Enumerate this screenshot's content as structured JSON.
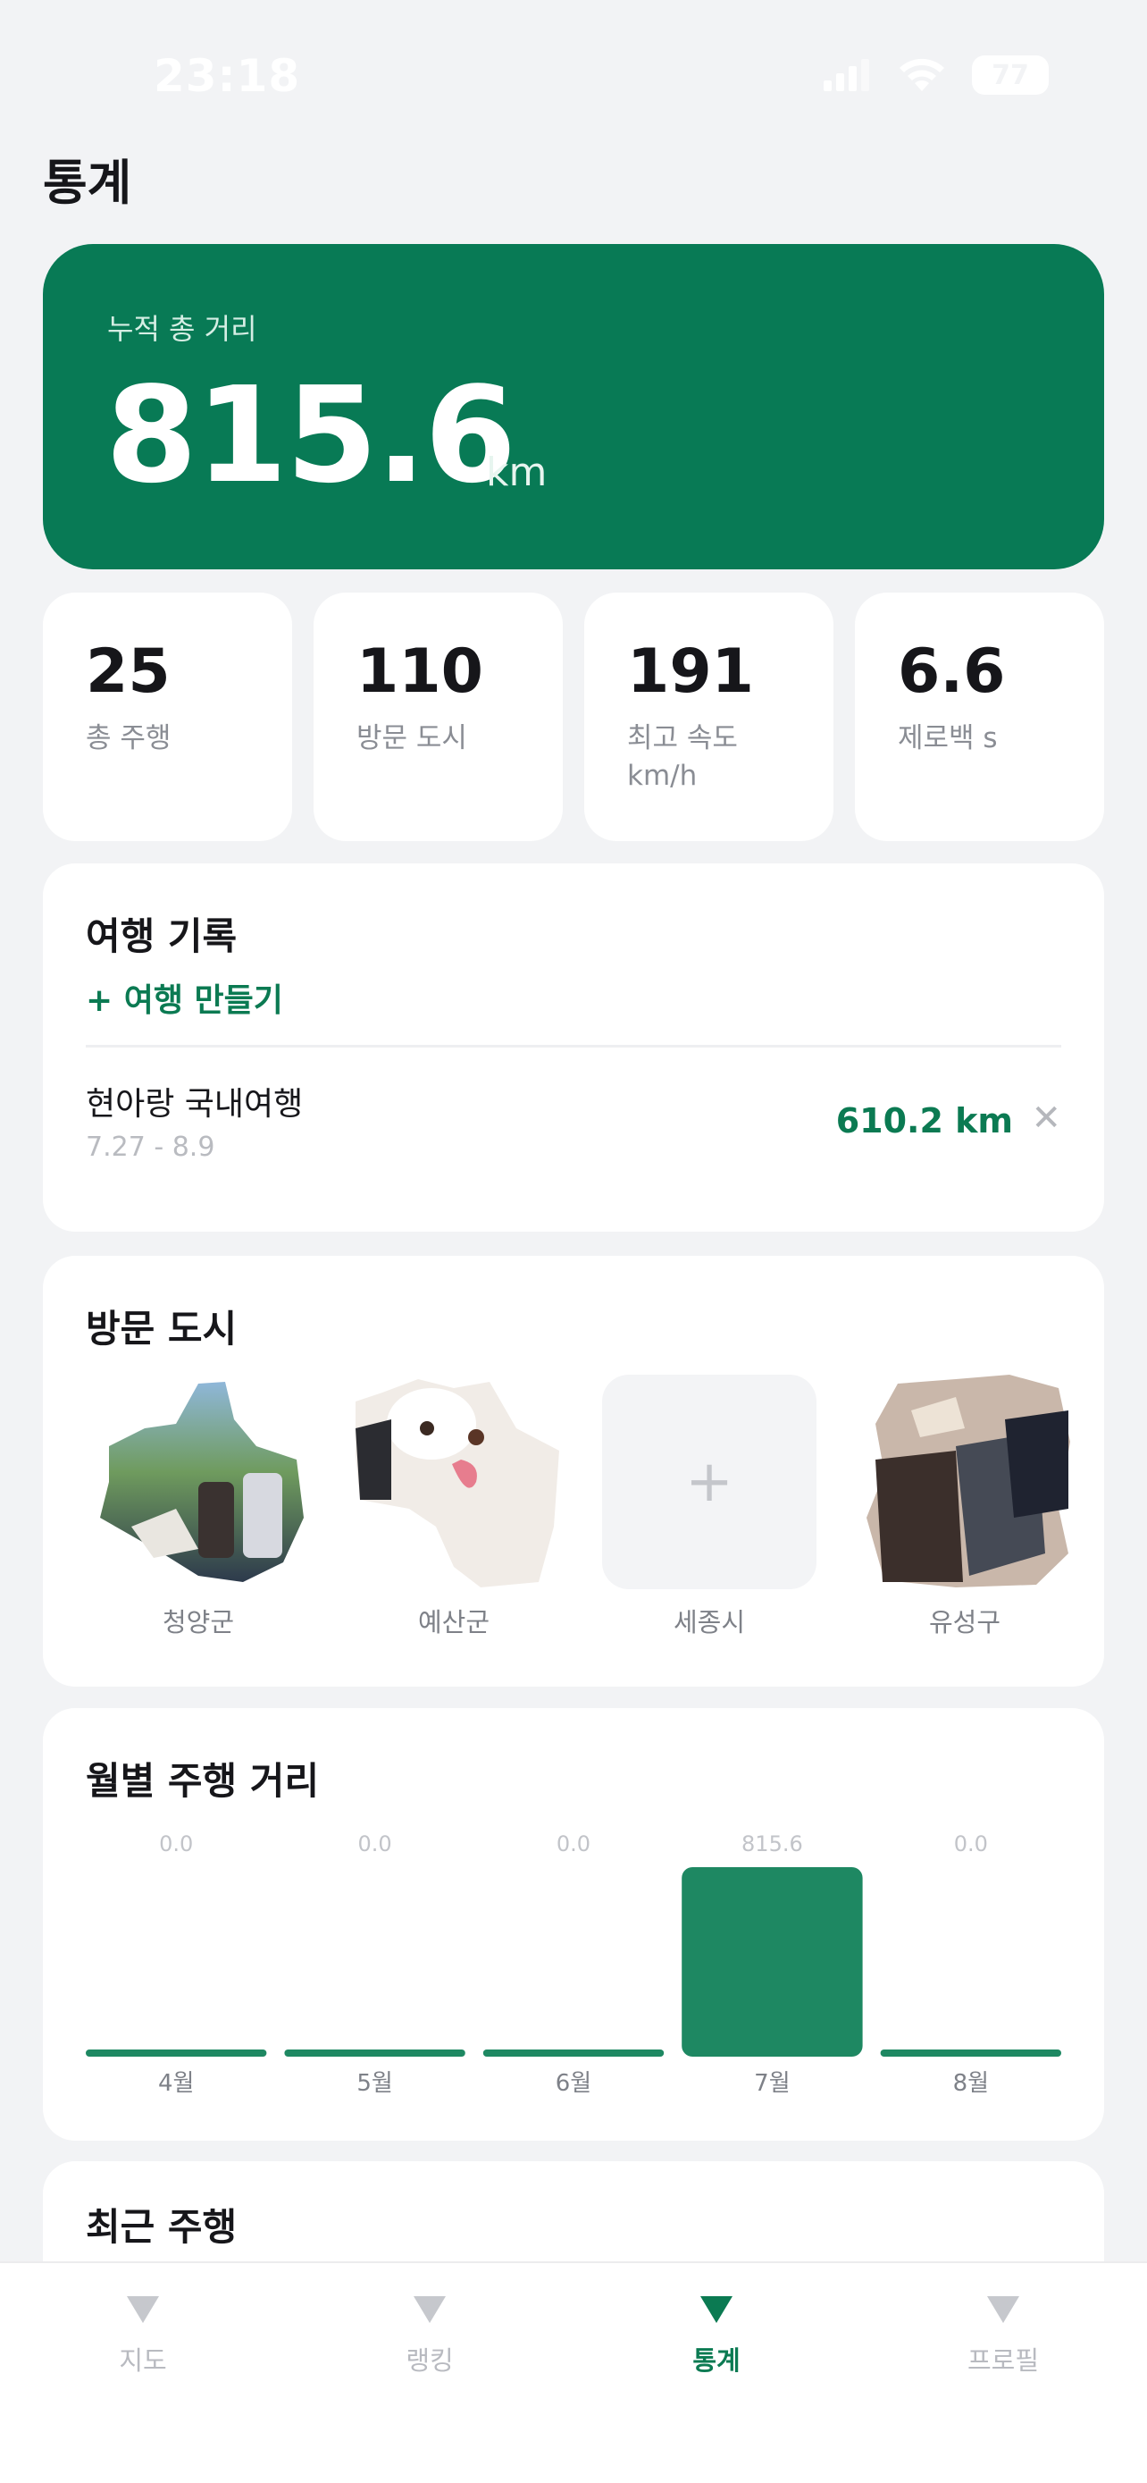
{
  "status": {
    "time": "23:18",
    "battery": "77"
  },
  "page_title": "통계",
  "hero": {
    "label": "누적 총 거리",
    "value": "815.6",
    "unit": "km"
  },
  "stats": [
    {
      "value": "25",
      "label": "총 주행"
    },
    {
      "value": "110",
      "label": "방문 도시"
    },
    {
      "value": "191",
      "label": "최고 속도 km/h"
    },
    {
      "value": "6.6",
      "label": "제로백 s"
    }
  ],
  "trips": {
    "title": "여행 기록",
    "add_label": "+ 여행 만들기",
    "items": [
      {
        "name": "현아랑 국내여행",
        "dates": "7.27 - 8.9",
        "distance": "610.2 km"
      }
    ]
  },
  "cities": {
    "title": "방문 도시",
    "items": [
      {
        "name": "청양군"
      },
      {
        "name": "예산군"
      },
      {
        "name": "세종시"
      },
      {
        "name": "유성구"
      }
    ],
    "add_icon": "plus-icon"
  },
  "monthly": {
    "title": "월별 주행 거리",
    "chart_data": {
      "type": "bar",
      "categories": [
        "4월",
        "5월",
        "6월",
        "7월",
        "8월"
      ],
      "values": [
        0.0,
        0.0,
        0.0,
        815.6,
        0.0
      ],
      "value_labels": [
        "0.0",
        "0.0",
        "0.0",
        "815.6",
        "0.0"
      ],
      "title": "월별 주행 거리",
      "color": "#1e8862",
      "grid": false
    }
  },
  "recent": {
    "title": "최근 주행"
  },
  "tabs": [
    {
      "label": "지도",
      "icon": "triangle-down-icon",
      "active": false
    },
    {
      "label": "랭킹",
      "icon": "triangle-down-icon",
      "active": false
    },
    {
      "label": "통계",
      "icon": "triangle-down-icon",
      "active": true
    },
    {
      "label": "프로필",
      "icon": "triangle-down-icon",
      "active": false
    }
  ],
  "colors": {
    "brand": "#087a55",
    "accent_text": "#0b7a52",
    "bar": "#1e8862",
    "background": "#f2f3f5"
  }
}
